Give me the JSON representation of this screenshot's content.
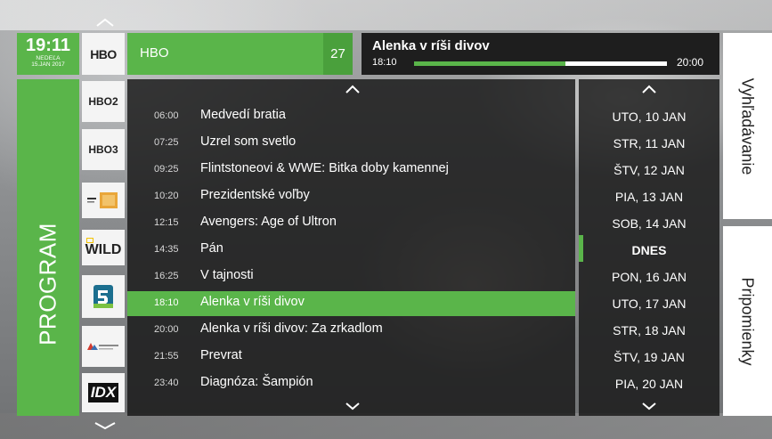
{
  "clock": {
    "time": "19:11",
    "day": "NEDEĽA",
    "date": "15.JAN 2017"
  },
  "program_tab": {
    "label": "PROGRAM"
  },
  "channel_logos": [
    {
      "name": "HBO",
      "text": "HBO"
    },
    {
      "name": "HBO2",
      "text": "HBO2"
    },
    {
      "name": "HBO3",
      "text": "HBO3"
    },
    {
      "name": "Film Europe"
    },
    {
      "name": "Nat Geo Wild",
      "text": "WILD"
    },
    {
      "name": "Sport5"
    },
    {
      "name": "Golf Channel"
    },
    {
      "name": "IDX",
      "text": "IDX"
    }
  ],
  "channel_header": {
    "name": "HBO",
    "number": "27"
  },
  "now_playing": {
    "title": "Alenka v ríši divov",
    "start": "18:10",
    "end": "20:00",
    "progress": 0.6
  },
  "side_tabs": {
    "search": "Vyhľadávanie",
    "reminders": "Pripomienky"
  },
  "programs": [
    {
      "time": "06:00",
      "title": "Medvedí bratia"
    },
    {
      "time": "07:25",
      "title": "Uzrel som svetlo"
    },
    {
      "time": "09:25",
      "title": "Flintstoneovi & WWE: Bitka doby kamennej"
    },
    {
      "time": "10:20",
      "title": "Prezidentské voľby"
    },
    {
      "time": "12:15",
      "title": "Avengers: Age of Ultron"
    },
    {
      "time": "14:35",
      "title": "Pán"
    },
    {
      "time": "16:25",
      "title": "V tajnosti"
    },
    {
      "time": "18:10",
      "title": "Alenka v ríši divov",
      "selected": true
    },
    {
      "time": "20:00",
      "title": "Alenka v ríši divov: Za zrkadlom"
    },
    {
      "time": "21:55",
      "title": "Prevrat"
    },
    {
      "time": "23:40",
      "title": "Diagnóza: Šampión"
    }
  ],
  "days": [
    "UTO, 10 JAN",
    "STR, 11 JAN",
    "ŠTV, 12 JAN",
    "PIA, 13 JAN",
    "SOB, 14 JAN",
    "DNES",
    "PON, 16 JAN",
    "UTO, 17 JAN",
    "STR, 18 JAN",
    "ŠTV, 19 JAN",
    "PIA, 20 JAN"
  ],
  "colors": {
    "accent": "#5ab54a",
    "panel": "#161616",
    "text": "#ffffff"
  }
}
